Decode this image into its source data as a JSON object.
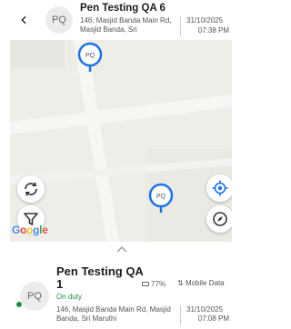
{
  "header": {
    "avatar_initials": "PQ",
    "name": "Pen Testing QA 6",
    "address": "146, Masjid Banda Main Rd, Masjid Banda, Sri",
    "date": "31/10/2025",
    "time": "07:38 PM"
  },
  "map": {
    "pins": [
      {
        "label": "PQ"
      },
      {
        "label": "PQ"
      }
    ],
    "attribution": [
      "G",
      "o",
      "o",
      "g",
      "l",
      "e"
    ],
    "colors": {
      "pin": "#1a73e8",
      "map_bg": "#efede8",
      "road": "#f7f6f2"
    }
  },
  "card": {
    "name_line1": "Pen Testing QA",
    "name_line2": "1",
    "avatar_initials": "PQ",
    "status": "On duty",
    "battery": "77%",
    "network": "Mobile Data",
    "address": "146, Masjid Banda Main Rd, Masjid Banda, Sri Maruthi",
    "date": "31/10/2025",
    "time": "07:08 PM",
    "colors": {
      "status": "#1e8e3e"
    }
  }
}
